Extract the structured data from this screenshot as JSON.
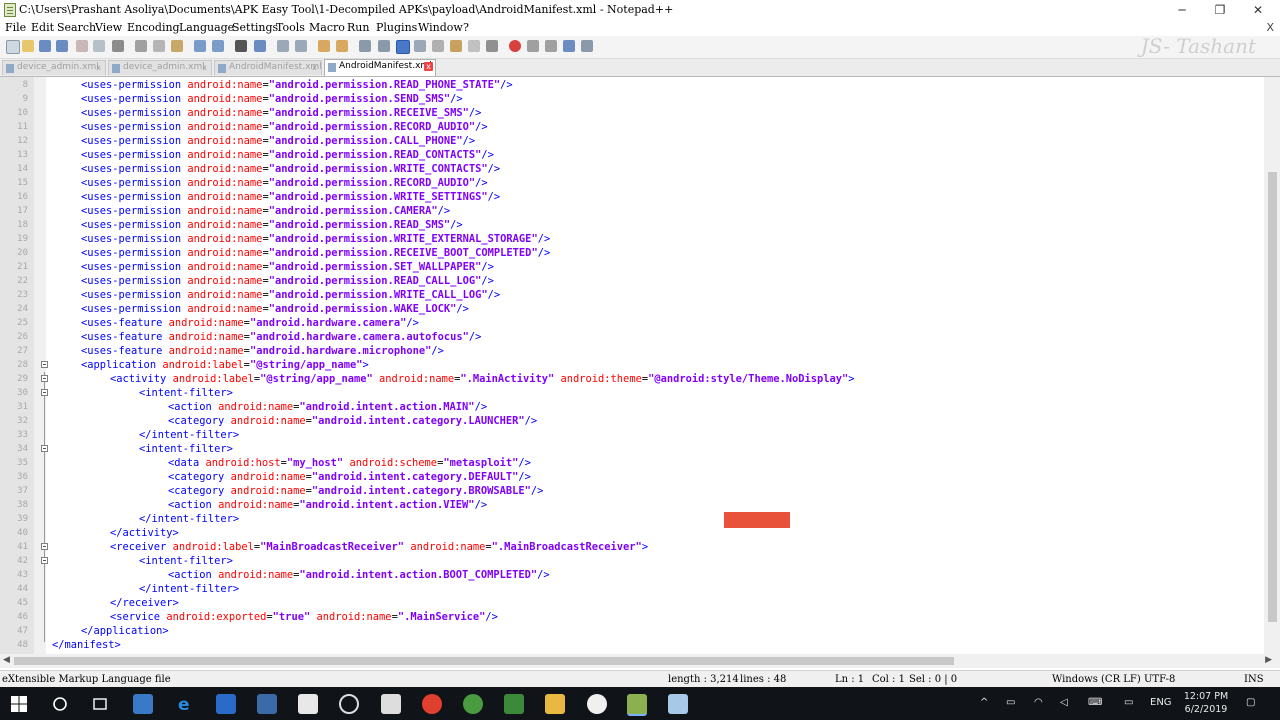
{
  "window": {
    "title": "C:\\Users\\Prashant Asoliya\\Documents\\APK Easy Tool\\1-Decompiled APKs\\payload\\AndroidManifest.xml - Notepad++",
    "minimize": "─",
    "maximize": "❐",
    "close": "✕"
  },
  "menu": [
    "File",
    "Edit",
    "Search",
    "View",
    "Encoding",
    "Language",
    "Settings",
    "Tools",
    "Macro",
    "Run",
    "Plugins",
    "Window",
    "?"
  ],
  "menu_close": "X",
  "watermark": "JS- Tashant",
  "tabs": [
    {
      "label": "device_admin.xml",
      "active": false
    },
    {
      "label": "device_admin.xml",
      "active": false
    },
    {
      "label": "AndroidManifest.xml",
      "active": false
    },
    {
      "label": "AndroidManifest.xml",
      "active": true
    }
  ],
  "editor": {
    "lines": [
      {
        "n": "8",
        "indent": 1,
        "kind": "perm",
        "tag": "uses-permission",
        "attr": "android:name",
        "val": "\"android.permission.READ_PHONE_STATE\""
      },
      {
        "n": "9",
        "indent": 1,
        "kind": "perm",
        "tag": "uses-permission",
        "attr": "android:name",
        "val": "\"android.permission.SEND_SMS\""
      },
      {
        "n": "10",
        "indent": 1,
        "kind": "perm",
        "tag": "uses-permission",
        "attr": "android:name",
        "val": "\"android.permission.RECEIVE_SMS\""
      },
      {
        "n": "11",
        "indent": 1,
        "kind": "perm",
        "tag": "uses-permission",
        "attr": "android:name",
        "val": "\"android.permission.RECORD_AUDIO\""
      },
      {
        "n": "12",
        "indent": 1,
        "kind": "perm",
        "tag": "uses-permission",
        "attr": "android:name",
        "val": "\"android.permission.CALL_PHONE\""
      },
      {
        "n": "13",
        "indent": 1,
        "kind": "perm",
        "tag": "uses-permission",
        "attr": "android:name",
        "val": "\"android.permission.READ_CONTACTS\""
      },
      {
        "n": "14",
        "indent": 1,
        "kind": "perm",
        "tag": "uses-permission",
        "attr": "android:name",
        "val": "\"android.permission.WRITE_CONTACTS\""
      },
      {
        "n": "15",
        "indent": 1,
        "kind": "perm",
        "tag": "uses-permission",
        "attr": "android:name",
        "val": "\"android.permission.RECORD_AUDIO\""
      },
      {
        "n": "16",
        "indent": 1,
        "kind": "perm",
        "tag": "uses-permission",
        "attr": "android:name",
        "val": "\"android.permission.WRITE_SETTINGS\""
      },
      {
        "n": "17",
        "indent": 1,
        "kind": "perm",
        "tag": "uses-permission",
        "attr": "android:name",
        "val": "\"android.permission.CAMERA\""
      },
      {
        "n": "18",
        "indent": 1,
        "kind": "perm",
        "tag": "uses-permission",
        "attr": "android:name",
        "val": "\"android.permission.READ_SMS\""
      },
      {
        "n": "19",
        "indent": 1,
        "kind": "perm",
        "tag": "uses-permission",
        "attr": "android:name",
        "val": "\"android.permission.WRITE_EXTERNAL_STORAGE\""
      },
      {
        "n": "20",
        "indent": 1,
        "kind": "perm",
        "tag": "uses-permission",
        "attr": "android:name",
        "val": "\"android.permission.RECEIVE_BOOT_COMPLETED\""
      },
      {
        "n": "21",
        "indent": 1,
        "kind": "perm",
        "tag": "uses-permission",
        "attr": "android:name",
        "val": "\"android.permission.SET_WALLPAPER\""
      },
      {
        "n": "22",
        "indent": 1,
        "kind": "perm",
        "tag": "uses-permission",
        "attr": "android:name",
        "val": "\"android.permission.READ_CALL_LOG\""
      },
      {
        "n": "23",
        "indent": 1,
        "kind": "perm",
        "tag": "uses-permission",
        "attr": "android:name",
        "val": "\"android.permission.WRITE_CALL_LOG\""
      },
      {
        "n": "24",
        "indent": 1,
        "kind": "perm",
        "tag": "uses-permission",
        "attr": "android:name",
        "val": "\"android.permission.WAKE_LOCK\""
      },
      {
        "n": "25",
        "indent": 1,
        "kind": "perm",
        "tag": "uses-feature",
        "attr": "android:name",
        "val": "\"android.hardware.camera\""
      },
      {
        "n": "26",
        "indent": 1,
        "kind": "perm",
        "tag": "uses-feature",
        "attr": "android:name",
        "val": "\"android.hardware.camera.autofocus\""
      },
      {
        "n": "27",
        "indent": 1,
        "kind": "perm",
        "tag": "uses-feature",
        "attr": "android:name",
        "val": "\"android.hardware.microphone\""
      },
      {
        "n": "28",
        "indent": 1,
        "kind": "open",
        "fold": true,
        "tag": "application",
        "parts": [
          [
            "android:label",
            "\"@string/app_name\""
          ]
        ]
      },
      {
        "n": "29",
        "indent": 2,
        "kind": "open",
        "fold": true,
        "tag": "activity",
        "parts": [
          [
            "android:label",
            "\"@string/app_name\""
          ],
          [
            "android:name",
            "\".MainActivity\""
          ],
          [
            "android:theme",
            "\"@android:style/Theme.NoDisplay\""
          ]
        ]
      },
      {
        "n": "30",
        "indent": 3,
        "kind": "open",
        "fold": true,
        "tag": "intent-filter",
        "parts": []
      },
      {
        "n": "31",
        "indent": 4,
        "kind": "self",
        "tag": "action",
        "parts": [
          [
            "android:name",
            "\"android.intent.action.MAIN\""
          ]
        ]
      },
      {
        "n": "32",
        "indent": 4,
        "kind": "self",
        "tag": "category",
        "parts": [
          [
            "android:name",
            "\"android.intent.category.LAUNCHER\""
          ]
        ]
      },
      {
        "n": "33",
        "indent": 3,
        "kind": "close",
        "tag": "intent-filter"
      },
      {
        "n": "34",
        "indent": 3,
        "kind": "open",
        "fold": true,
        "tag": "intent-filter",
        "parts": []
      },
      {
        "n": "35",
        "indent": 4,
        "kind": "self",
        "tag": "data",
        "parts": [
          [
            "android:host",
            "\"my_host\""
          ],
          [
            "android:scheme",
            "\"metasploit\""
          ]
        ]
      },
      {
        "n": "36",
        "indent": 4,
        "kind": "self",
        "tag": "category",
        "parts": [
          [
            "android:name",
            "\"android.intent.category.DEFAULT\""
          ]
        ]
      },
      {
        "n": "37",
        "indent": 4,
        "kind": "self",
        "tag": "category",
        "parts": [
          [
            "android:name",
            "\"android.intent.category.BROWSABLE\""
          ]
        ]
      },
      {
        "n": "38",
        "indent": 4,
        "kind": "self",
        "tag": "action",
        "parts": [
          [
            "android:name",
            "\"android.intent.action.VIEW\""
          ]
        ]
      },
      {
        "n": "39",
        "indent": 3,
        "kind": "close",
        "tag": "intent-filter"
      },
      {
        "n": "40",
        "indent": 2,
        "kind": "close",
        "tag": "activity"
      },
      {
        "n": "41",
        "indent": 2,
        "kind": "open",
        "fold": true,
        "tag": "receiver",
        "parts": [
          [
            "android:label",
            "\"MainBroadcastReceiver\""
          ],
          [
            "android:name",
            "\".MainBroadcastReceiver\""
          ]
        ]
      },
      {
        "n": "42",
        "indent": 3,
        "kind": "open",
        "fold": true,
        "tag": "intent-filter",
        "parts": []
      },
      {
        "n": "43",
        "indent": 4,
        "kind": "self",
        "tag": "action",
        "parts": [
          [
            "android:name",
            "\"android.intent.action.BOOT_COMPLETED\""
          ]
        ]
      },
      {
        "n": "44",
        "indent": 3,
        "kind": "close",
        "tag": "intent-filter"
      },
      {
        "n": "45",
        "indent": 2,
        "kind": "close",
        "tag": "receiver"
      },
      {
        "n": "46",
        "indent": 2,
        "kind": "self",
        "tag": "service",
        "parts": [
          [
            "android:exported",
            "\"true\""
          ],
          [
            "android:name",
            "\".MainService\""
          ]
        ]
      },
      {
        "n": "47",
        "indent": 1,
        "kind": "close",
        "tag": "application"
      },
      {
        "n": "48",
        "indent": 0,
        "kind": "close",
        "tag": "manifest"
      }
    ]
  },
  "statusbar": {
    "filetype": "eXtensible Markup Language file",
    "length": "length : 3,214",
    "lines": "lines : 48",
    "ln": "Ln : 1",
    "col": "Col : 1",
    "sel": "Sel : 0 | 0",
    "eol": "Windows (CR LF)",
    "encoding": "UTF-8",
    "mode": "INS"
  },
  "taskbar": {
    "lang": "ENG",
    "time": "12:07 PM",
    "date": "6/2/2019"
  },
  "colors": {
    "tag": "#0000ff",
    "attr": "#ff0000",
    "value": "#8000ff",
    "taskbar": "#101418"
  }
}
